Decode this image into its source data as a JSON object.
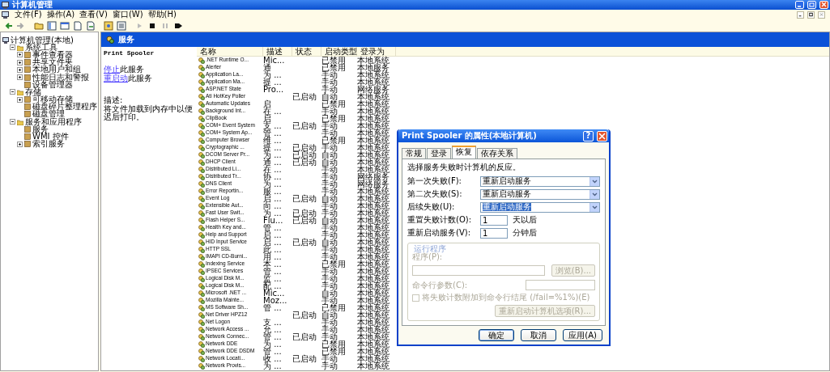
{
  "window": {
    "title": "计算机管理"
  },
  "menu": [
    "文件(F)",
    "操作(A)",
    "查看(V)",
    "窗口(W)",
    "帮助(H)"
  ],
  "tree": [
    {
      "label": "计算机管理(本地)",
      "children": [
        {
          "label": "系统工具",
          "expanded": true,
          "children": [
            {
              "label": "事件查看器",
              "expanded": false
            },
            {
              "label": "共享文件夹",
              "expanded": false
            },
            {
              "label": "本地用户和组",
              "expanded": false
            },
            {
              "label": "性能日志和警报",
              "expanded": false
            },
            {
              "label": "设备管理器"
            }
          ]
        },
        {
          "label": "存储",
          "expanded": true,
          "children": [
            {
              "label": "可移动存储",
              "expanded": false
            },
            {
              "label": "磁盘碎片整理程序"
            },
            {
              "label": "磁盘管理"
            }
          ]
        },
        {
          "label": "服务和应用程序",
          "expanded": true,
          "children": [
            {
              "label": "服务"
            },
            {
              "label": "WMI 控件"
            },
            {
              "label": "索引服务",
              "expanded": false
            }
          ]
        }
      ]
    }
  ],
  "panel": {
    "title": "服务"
  },
  "details": {
    "service": "Print Spooler",
    "actions": [
      {
        "link": "停止",
        "text": "此服务"
      },
      {
        "link": "重启动",
        "text": "此服务"
      }
    ],
    "description_label": "描述:",
    "description": "将文件加载到内存中以便迟后打印。"
  },
  "table": {
    "columns": [
      "名称",
      "描述",
      "状态",
      "启动类型",
      "登录为"
    ],
    "rows": [
      {
        "name": ".NET Runtime O...",
        "description": "Mic...",
        "startup": "已禁用",
        "logon": "本地系统"
      },
      {
        "name": "Alerter",
        "description": "通",
        "startup": "已禁用",
        "logon": "本地服务"
      },
      {
        "name": "Application La...",
        "description": "为 ...",
        "startup": "手动",
        "logon": "本地系统"
      },
      {
        "name": "Application Ma...",
        "description": "提 ...",
        "startup": "手动",
        "logon": "本地系统"
      },
      {
        "name": "ASP.NET State",
        "description": "Pro...",
        "startup": "手动",
        "logon": "网络服务"
      },
      {
        "name": "Ati HotKey Poller",
        "status": "已启动",
        "startup": "自动",
        "logon": "本地系统"
      },
      {
        "name": "Automatic Updates",
        "description": "启",
        "startup": "已禁用",
        "logon": "本地系统"
      },
      {
        "name": "Background Int...",
        "description": "在 ...",
        "startup": "手动",
        "logon": "本地系统"
      },
      {
        "name": "ClipBook",
        "description": "启",
        "startup": "已禁用",
        "logon": "本地系统"
      },
      {
        "name": "COM+ Event System",
        "description": "支 ...",
        "status": "已启动",
        "startup": "手动",
        "logon": "本地系统"
      },
      {
        "name": "COM+ System Ap...",
        "description": "管 ...",
        "startup": "手动",
        "logon": "本地系统"
      },
      {
        "name": "Computer Browser",
        "description": "维 ...",
        "startup": "已禁用",
        "logon": "本地系统"
      },
      {
        "name": "Cryptographic ...",
        "description": "提 ...",
        "status": "已启动",
        "startup": "手动",
        "logon": "本地系统"
      },
      {
        "name": "DCOM Server Pr...",
        "description": "为 ...",
        "status": "已启动",
        "startup": "自动",
        "logon": "本地系统"
      },
      {
        "name": "DHCP Client",
        "description": "通 ...",
        "status": "已启动",
        "startup": "自动",
        "logon": "本地系统"
      },
      {
        "name": "Distributed Li...",
        "description": "在 ...",
        "startup": "手动",
        "logon": "本地系统"
      },
      {
        "name": "Distributed Tr...",
        "description": "协 ...",
        "startup": "手动",
        "logon": "网络服务"
      },
      {
        "name": "DNS Client",
        "description": "为 ...",
        "startup": "手动",
        "logon": "网络服务"
      },
      {
        "name": "Error Reportin...",
        "description": "服 ...",
        "startup": "手动",
        "logon": "本地系统"
      },
      {
        "name": "Event Log",
        "description": "启 ...",
        "status": "已启动",
        "startup": "自动",
        "logon": "本地系统"
      },
      {
        "name": "Extensible Aut...",
        "description": "向 ...",
        "startup": "手动",
        "logon": "本地系统"
      },
      {
        "name": "Fast User Swit...",
        "description": "为 ...",
        "status": "已启动",
        "startup": "手动",
        "logon": "本地系统"
      },
      {
        "name": "Flash Helper S...",
        "description": "Flu...",
        "status": "已启动",
        "startup": "自动",
        "logon": "本地系统"
      },
      {
        "name": "Health Key and...",
        "description": "管 ...",
        "startup": "手动",
        "logon": "本地系统"
      },
      {
        "name": "Help and Support",
        "description": "启 ...",
        "startup": "手动",
        "logon": "本地系统"
      },
      {
        "name": "HID Input Service",
        "description": "启 ...",
        "status": "已启动",
        "startup": "自动",
        "logon": "本地系统"
      },
      {
        "name": "HTTP SSL",
        "description": "此 ...",
        "startup": "手动",
        "logon": "本地系统"
      },
      {
        "name": "IMAPI CD-Burni...",
        "description": "用 ...",
        "startup": "手动",
        "logon": "本地系统"
      },
      {
        "name": "Indexing Service",
        "description": "本 ...",
        "startup": "已禁用",
        "logon": "本地系统"
      },
      {
        "name": "IPSEC Services",
        "description": "管 ...",
        "startup": "手动",
        "logon": "本地系统"
      },
      {
        "name": "Logical Disk M...",
        "description": "监 ...",
        "startup": "手动",
        "logon": "本地系统"
      },
      {
        "name": "Logical Disk M...",
        "description": "配 ...",
        "startup": "手动",
        "logon": "本地系统"
      },
      {
        "name": "Microsoft .NET ...",
        "description": "Mic...",
        "startup": "自动",
        "logon": "本地系统"
      },
      {
        "name": "Mozilla Mainte...",
        "description": "Moz...",
        "startup": "手动",
        "logon": "本地系统"
      },
      {
        "name": "MS Software Sh...",
        "description": "管 ...",
        "startup": "已禁用",
        "logon": "本地系统"
      },
      {
        "name": "Net Driver HPZ12",
        "status": "已启动",
        "startup": "自动",
        "logon": "本地系统"
      },
      {
        "name": "Net Logon",
        "description": "支 ...",
        "startup": "手动",
        "logon": "本地系统"
      },
      {
        "name": "Network Access ...",
        "description": "允 ...",
        "startup": "手动",
        "logon": "本地系统"
      },
      {
        "name": "Network Connec...",
        "description": "管 ...",
        "status": "已启动",
        "startup": "手动",
        "logon": "本地系统"
      },
      {
        "name": "Network DDE",
        "description": "为 ...",
        "startup": "已禁用",
        "logon": "本地系统"
      },
      {
        "name": "Network DDE DSDM",
        "description": "管 ...",
        "startup": "已禁用",
        "logon": "本地系统"
      },
      {
        "name": "Network Locati...",
        "description": "收 ...",
        "status": "已启动",
        "startup": "手动",
        "logon": "本地系统"
      },
      {
        "name": "Network Provis...",
        "description": "为 ...",
        "startup": "手动",
        "logon": "本地系统"
      }
    ]
  },
  "dialog": {
    "title": "Print Spooler 的属性(本地计算机)",
    "help_button": "?",
    "tabs": [
      {
        "label": "常规",
        "selected": false
      },
      {
        "label": "登录",
        "selected": false
      },
      {
        "label": "恢复",
        "selected": true
      },
      {
        "label": "依存关系",
        "selected": false
      }
    ],
    "intro": "选择服务失败时计算机的反应。",
    "failures": [
      {
        "label": "第一次失败(F):",
        "value": "重新启动服务",
        "highlighted": false
      },
      {
        "label": "第二次失败(S):",
        "value": "重新启动服务",
        "highlighted": false
      },
      {
        "label": "后续失败(U):",
        "value": "重新启动服务",
        "highlighted": true
      }
    ],
    "counters": [
      {
        "label": "重置失败计数(O):",
        "value": "1",
        "unit": "天以后"
      },
      {
        "label": "重新启动服务(V):",
        "value": "1",
        "unit": "分钟后"
      }
    ],
    "run_program": {
      "title": "运行程序",
      "disabled": true,
      "program_label": "程序(P):",
      "browse": "浏览(B)...",
      "params_label": "命令行参数(C):",
      "append_label": "将失败计数附加到命令行结尾 (/fail=%1%)(E)",
      "append_checked": false,
      "restart_options": "重新启动计算机选项(R)..."
    },
    "buttons": [
      "确定",
      "取消",
      "应用(A)"
    ]
  }
}
